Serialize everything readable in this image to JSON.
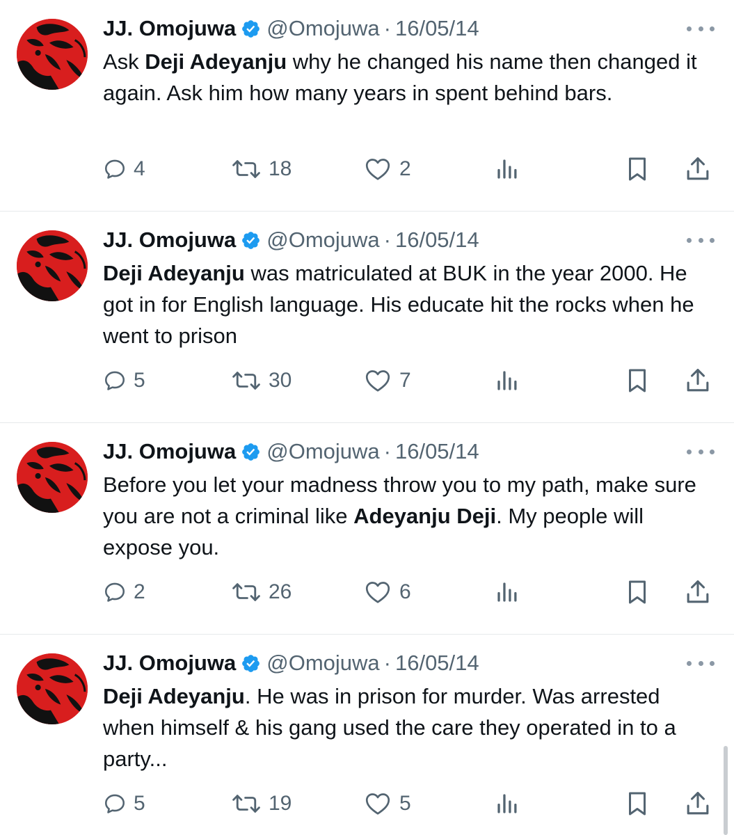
{
  "tweets": [
    {
      "author": {
        "name": "JJ. Omojuwa",
        "handle": "@Omojuwa",
        "verified": true
      },
      "separator": "·",
      "date": "16/05/14",
      "text_parts": [
        {
          "t": "Ask ",
          "bold": false
        },
        {
          "t": "Deji Adeyanju",
          "bold": true
        },
        {
          "t": " why he changed his name then changed it again. Ask him how many years in spent behind bars.",
          "bold": false
        }
      ],
      "stats": {
        "replies": "4",
        "retweets": "18",
        "likes": "2"
      }
    },
    {
      "author": {
        "name": "JJ. Omojuwa",
        "handle": "@Omojuwa",
        "verified": true
      },
      "separator": "·",
      "date": "16/05/14",
      "text_parts": [
        {
          "t": "Deji Adeyanju",
          "bold": true
        },
        {
          "t": " was matriculated at BUK in the year 2000. He got in for English language. His educate hit the rocks when he went to prison",
          "bold": false
        }
      ],
      "stats": {
        "replies": "5",
        "retweets": "30",
        "likes": "7"
      }
    },
    {
      "author": {
        "name": "JJ. Omojuwa",
        "handle": "@Omojuwa",
        "verified": true
      },
      "separator": "·",
      "date": "16/05/14",
      "text_parts": [
        {
          "t": "Before you let your madness throw you to my path, make sure you are not a criminal like ",
          "bold": false
        },
        {
          "t": "Adeyanju Deji",
          "bold": true
        },
        {
          "t": ". My people will expose you.",
          "bold": false
        }
      ],
      "stats": {
        "replies": "2",
        "retweets": "26",
        "likes": "6"
      }
    },
    {
      "author": {
        "name": "JJ. Omojuwa",
        "handle": "@Omojuwa",
        "verified": true
      },
      "separator": "·",
      "date": "16/05/14",
      "text_parts": [
        {
          "t": "Deji Adeyanju",
          "bold": true
        },
        {
          "t": ". He was in prison for murder. Was arrested when himself & his gang used the care they operated in to a party...",
          "bold": false
        }
      ],
      "stats": {
        "replies": "5",
        "retweets": "19",
        "likes": "5"
      }
    }
  ],
  "icons": {
    "avatar": "avatar-portrait-red",
    "verified": "verified-badge-icon",
    "more": "more-options-icon",
    "reply": "reply-icon",
    "retweet": "retweet-icon",
    "like": "heart-icon",
    "views": "views-icon",
    "bookmark": "bookmark-icon",
    "share": "share-icon"
  },
  "colors": {
    "text": "#0f1419",
    "secondary": "#536471",
    "verified": "#1d9bf0",
    "avatar_bg": "#d81e1e",
    "divider": "#e6e9eb"
  }
}
